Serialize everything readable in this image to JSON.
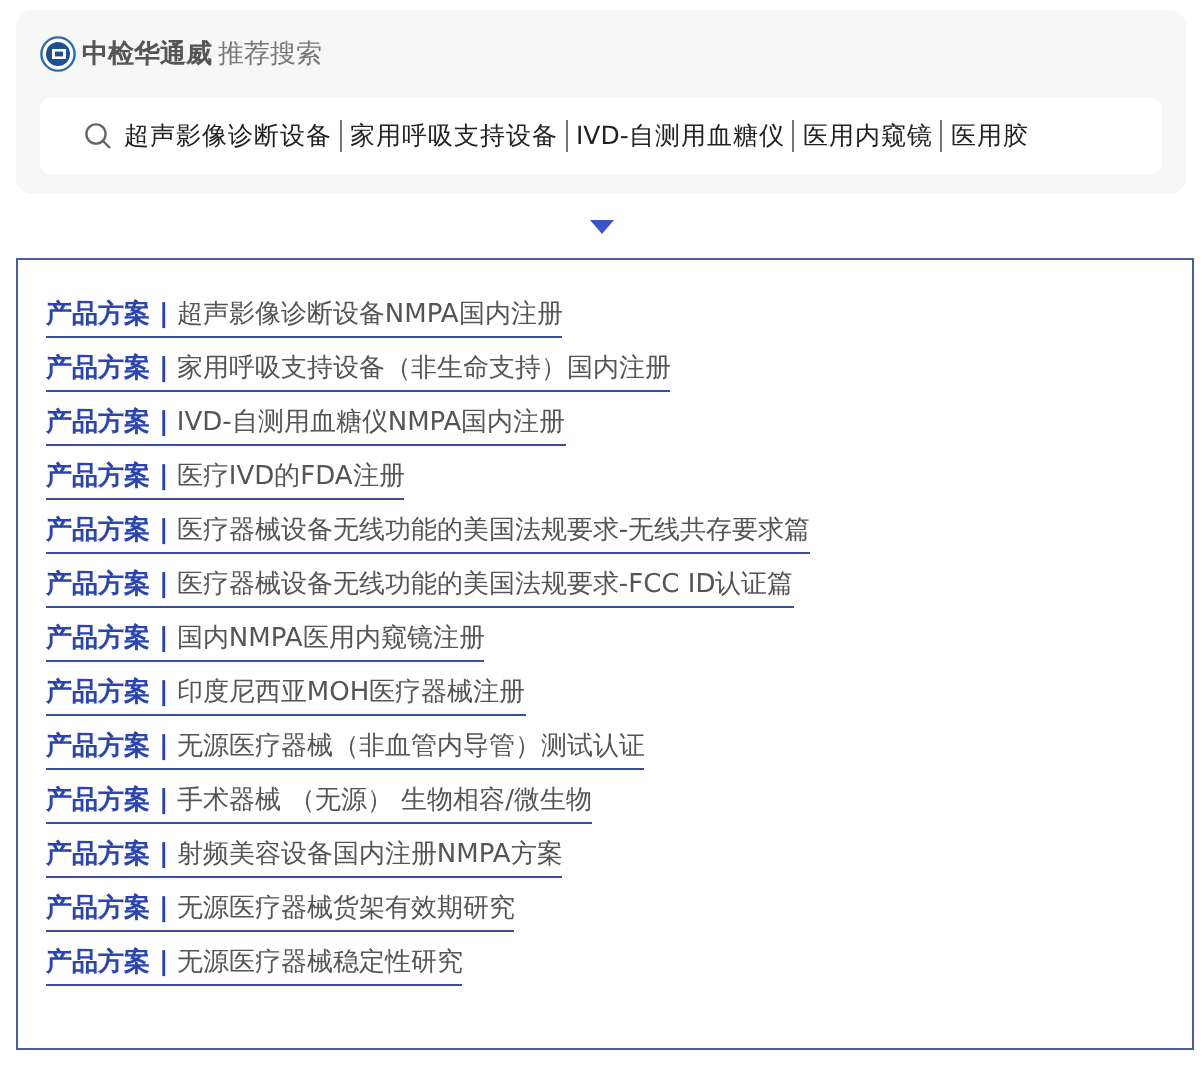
{
  "header": {
    "brand": "中检华通威",
    "title": "推荐搜索"
  },
  "search": {
    "keywords": [
      "超声影像诊断设备",
      "家用呼吸支持设备",
      "IVD-自测用血糖仪",
      "医用内窥镜",
      "医用胶"
    ]
  },
  "links": [
    {
      "tag": "产品方案 |",
      "title": "超声影像诊断设备NMPA国内注册"
    },
    {
      "tag": "产品方案 |",
      "title": "家用呼吸支持设备（非生命支持）国内注册"
    },
    {
      "tag": "产品方案 |",
      "title": "IVD-自测用血糖仪NMPA国内注册"
    },
    {
      "tag": "产品方案 |",
      "title": "医疗IVD的FDA注册"
    },
    {
      "tag": "产品方案 |",
      "title": "医疗器械设备无线功能的美国法规要求-无线共存要求篇"
    },
    {
      "tag": "产品方案 |",
      "title": "医疗器械设备无线功能的美国法规要求-FCC ID认证篇"
    },
    {
      "tag": "产品方案 |",
      "title": "国内NMPA医用内窥镜注册"
    },
    {
      "tag": "产品方案 |",
      "title": "印度尼西亚MOH医疗器械注册"
    },
    {
      "tag": "产品方案 |",
      "title": "无源医疗器械（非血管内导管）测试认证"
    },
    {
      "tag": "产品方案 |",
      "title": "手术器械 （无源） 生物相容/微生物"
    },
    {
      "tag": "产品方案 |",
      "title": "射频美容设备国内注册NMPA方案"
    },
    {
      "tag": "产品方案 |",
      "title": "无源医疗器械货架有效期研究"
    },
    {
      "tag": "产品方案 |",
      "title": "无源医疗器械稳定性研究"
    }
  ]
}
